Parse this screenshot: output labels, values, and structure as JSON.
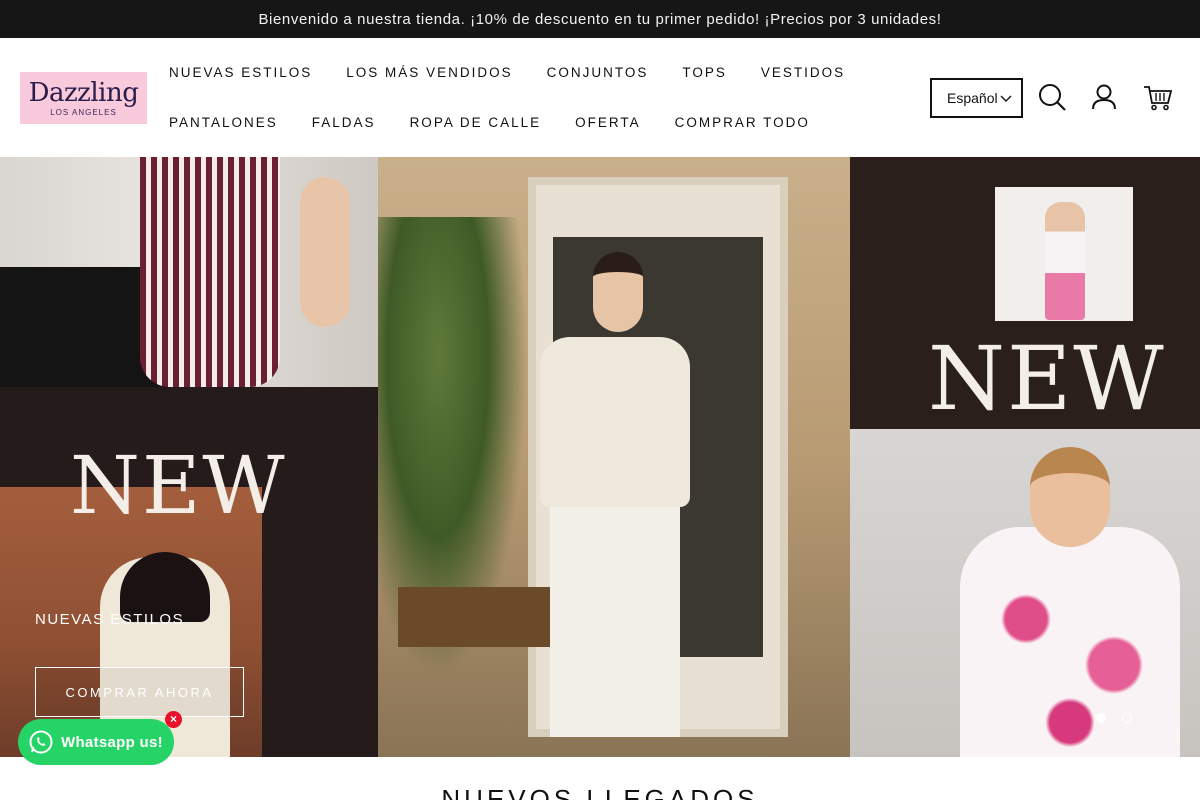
{
  "announcement": "Bienvenido a nuestra tienda. ¡10% de descuento en tu primer pedido! ¡Precios por 3 unidades!",
  "logo": {
    "brand": "Dazzling",
    "city": "LOS ANGELES"
  },
  "nav": {
    "row1": [
      "NUEVAS ESTILOS",
      "LOS MÁS VENDIDOS",
      "CONJUNTOS",
      "TOPS",
      "VESTIDOS"
    ],
    "row2": [
      "PANTALONES",
      "FALDAS",
      "ROPA DE CALLE",
      "OFERTA",
      "COMPRAR TODO"
    ]
  },
  "header": {
    "language": "Español",
    "icons": [
      "search-icon",
      "account-icon",
      "cart-icon"
    ]
  },
  "hero": {
    "new_mark_left": "NEW",
    "new_mark_right": "NEW",
    "title": "NUEVAS ESTILOS",
    "button": "COMPRAR AHORA",
    "slides": 2,
    "active_slide": 1
  },
  "whatsapp": {
    "label": "Whatsapp us!",
    "close": "×"
  },
  "section": {
    "title": "NUEVOS LLEGADOS"
  },
  "colors": {
    "announce_bg": "#161616",
    "whatsapp": "#25d366",
    "logo_bg": "#f9c9dc"
  }
}
